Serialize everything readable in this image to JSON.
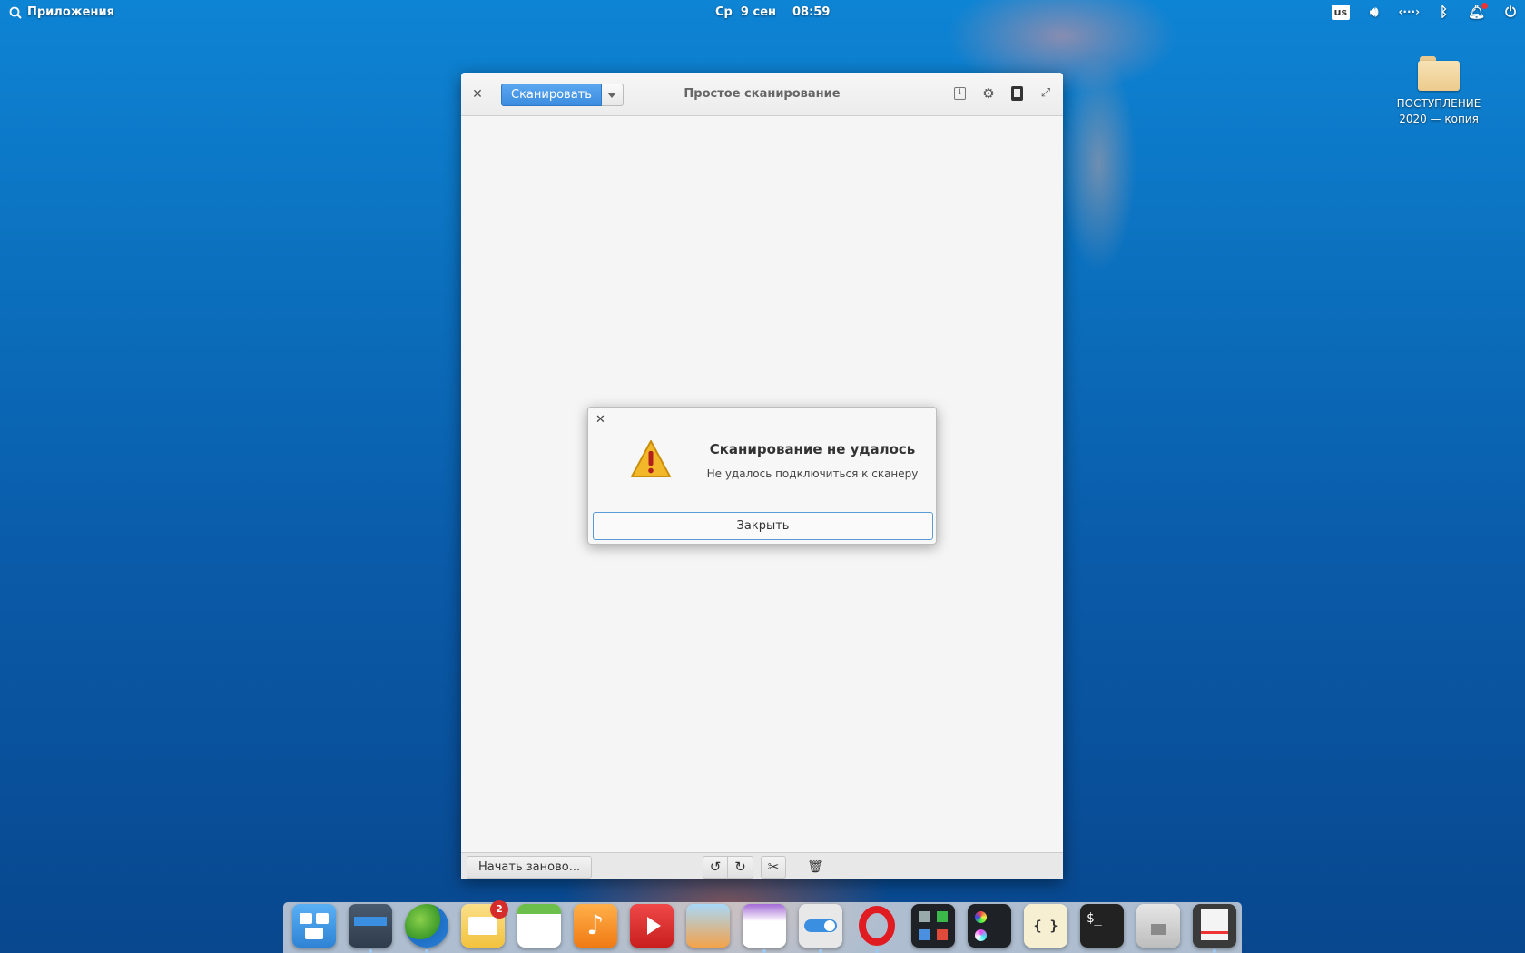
{
  "topbar": {
    "apps_label": "Приложения",
    "day": "Ср",
    "date": "9 сен",
    "time": "08:59",
    "keyboard_layout": "us"
  },
  "desktop": {
    "folder_label_line1": "ПОСТУПЛЕНИЕ",
    "folder_label_line2": "2020 — копия"
  },
  "window": {
    "title": "Простое сканирование",
    "scan_label": "Сканировать",
    "restart_label": "Начать заново..."
  },
  "dialog": {
    "title": "Сканирование не удалось",
    "message": "Не удалось подключиться к сканеру",
    "close_label": "Закрыть"
  },
  "dock": {
    "mail_badge": "2",
    "code_glyph": "{ }",
    "terminal_glyph": "$_",
    "items": [
      "multitasking-view",
      "appcenter-grid",
      "web-browser",
      "mail",
      "calendar",
      "music",
      "videos",
      "photos",
      "appcenter",
      "system-settings",
      "opera",
      "office",
      "color-picker",
      "code",
      "terminal",
      "files",
      "simple-scan"
    ]
  },
  "colors": {
    "accent": "#3c8de0",
    "badge": "#d52b2b",
    "warning": "#f0b400"
  }
}
